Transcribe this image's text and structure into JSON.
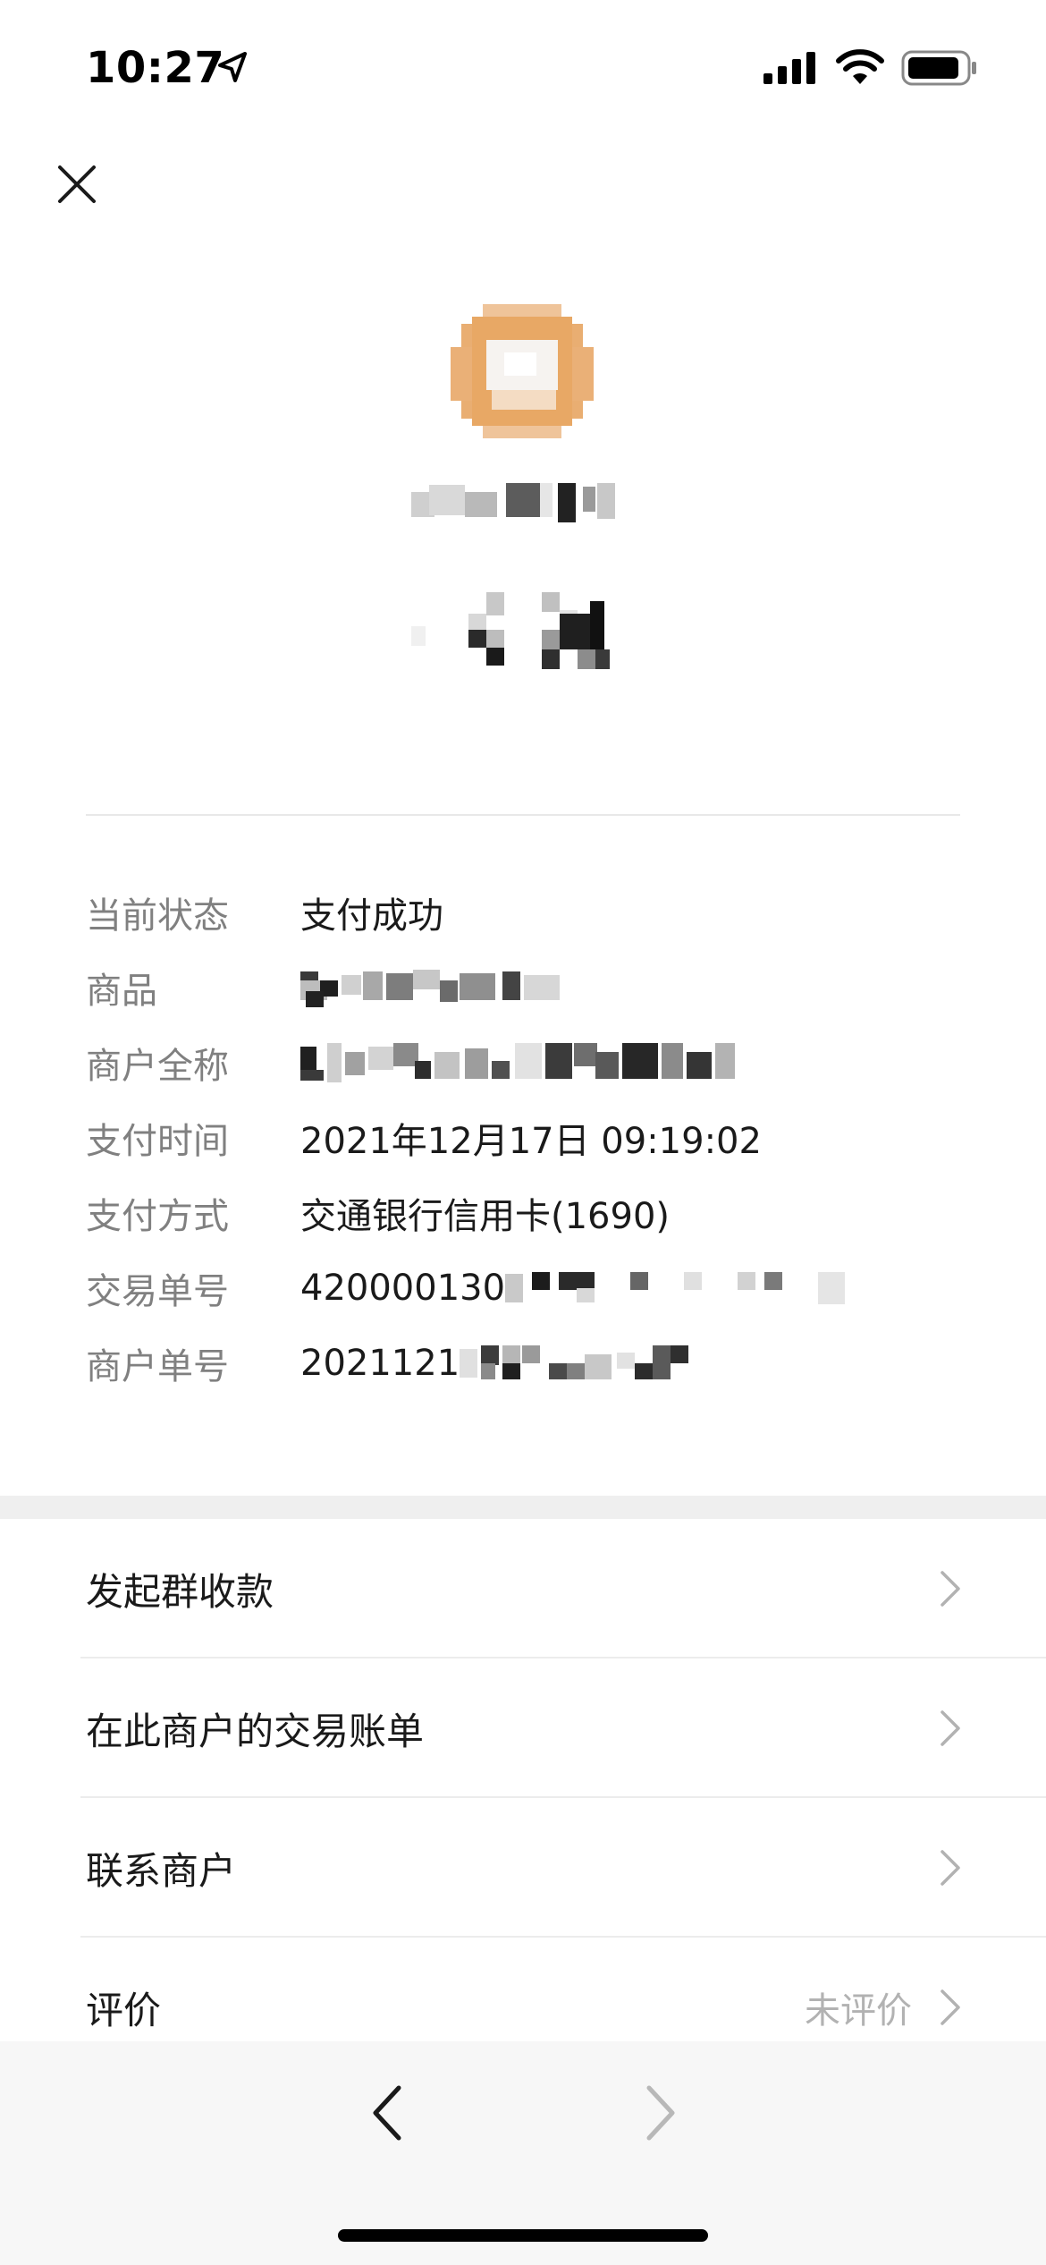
{
  "status_bar": {
    "time": "10:27"
  },
  "details": [
    {
      "label": "当前状态",
      "value": "支付成功"
    },
    {
      "label": "商品",
      "value": ""
    },
    {
      "label": "商户全称",
      "value": ""
    },
    {
      "label": "支付时间",
      "value": "2021年12月17日 09:19:02"
    },
    {
      "label": "支付方式",
      "value": "交通银行信用卡(1690)"
    },
    {
      "label": "交易单号",
      "value": "420000130"
    },
    {
      "label": "商户单号",
      "value": "2021121"
    }
  ],
  "actions": [
    {
      "label": "发起群收款",
      "extra": ""
    },
    {
      "label": "在此商户的交易账单",
      "extra": ""
    },
    {
      "label": "联系商户",
      "extra": ""
    },
    {
      "label": "评价",
      "extra": "未评价"
    }
  ],
  "colors": {
    "avatar_orange": "#e8a865",
    "label_gray": "#808080",
    "extra_gray": "#b2b2b2",
    "bottom_bar": "#f7f7f7"
  },
  "icons": {
    "close": "close-icon",
    "location": "location-arrow-icon",
    "signal": "cellular-signal-icon",
    "wifi": "wifi-icon",
    "battery": "battery-icon",
    "chevron": "chevron-right-icon",
    "back": "chevron-left-icon",
    "forward": "chevron-right-icon"
  }
}
